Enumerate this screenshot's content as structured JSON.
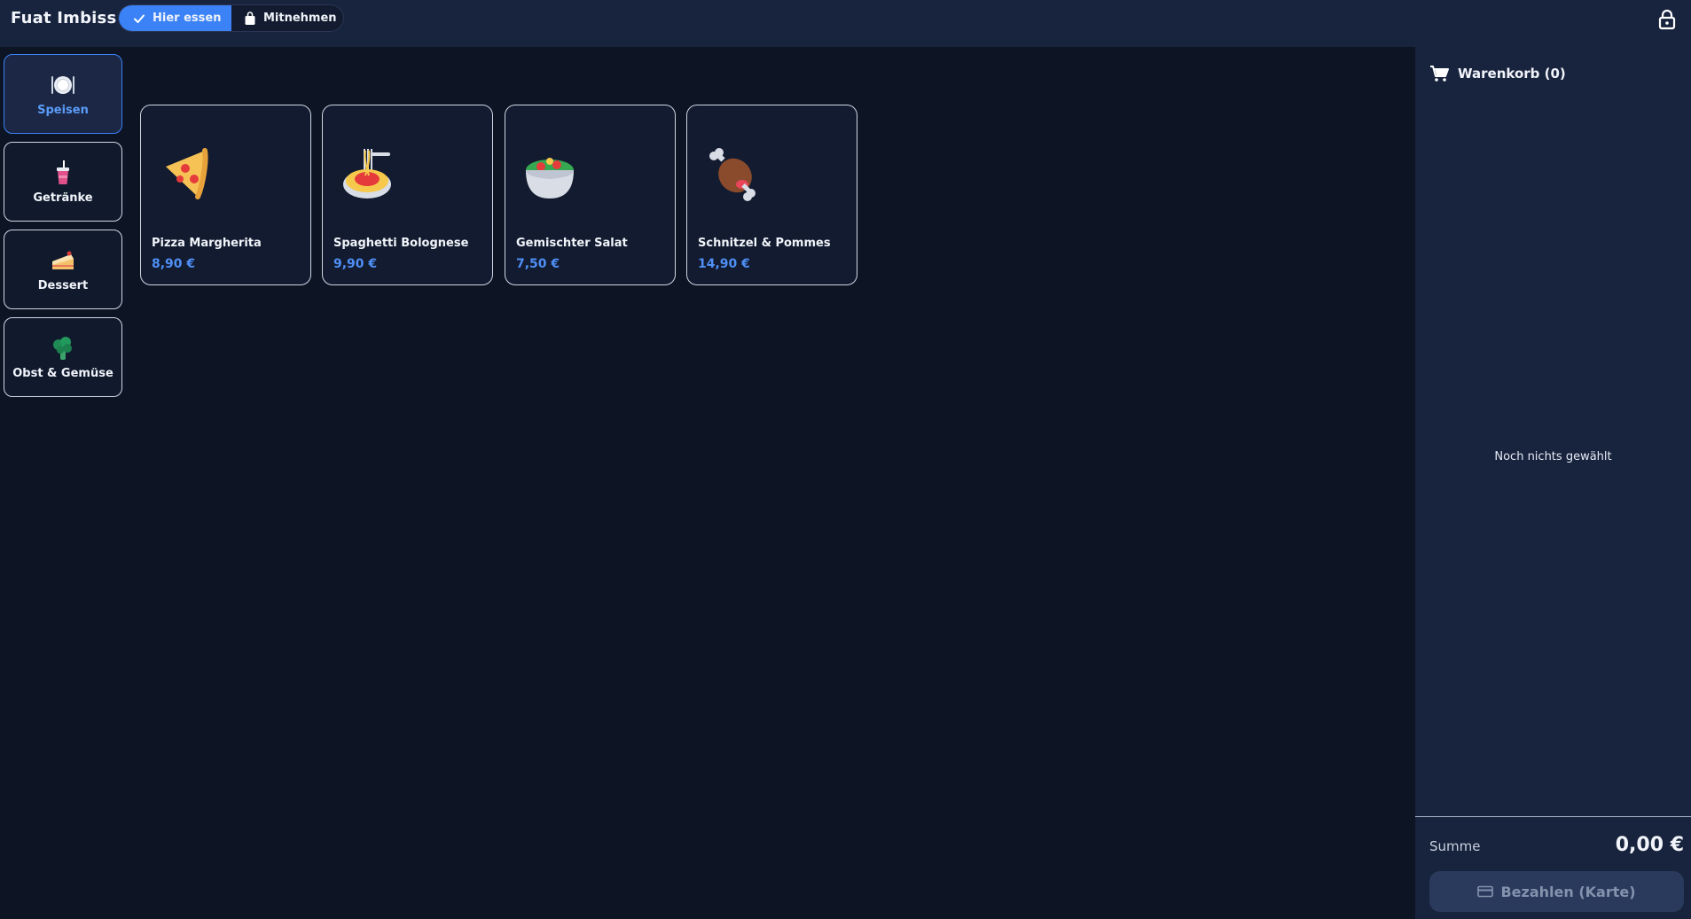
{
  "header": {
    "brand": "Fuat Imbiss",
    "modes": [
      {
        "label": "Hier essen",
        "icon": "check-icon",
        "active": true
      },
      {
        "label": "Mitnehmen",
        "icon": "bag-icon",
        "active": false
      }
    ],
    "lock_icon": "lock-icon"
  },
  "categories": [
    {
      "label": "Speisen",
      "icon": "plate-icon",
      "active": true
    },
    {
      "label": "Getränke",
      "icon": "drink-cup-icon",
      "active": false
    },
    {
      "label": "Dessert",
      "icon": "cake-slice-icon",
      "active": false
    },
    {
      "label": "Obst & Gemüse",
      "icon": "broccoli-icon",
      "active": false
    }
  ],
  "products": [
    {
      "name": "Pizza Margherita",
      "price": "8,90 €",
      "icon": "pizza-icon"
    },
    {
      "name": "Spaghetti Bolognese",
      "price": "9,90 €",
      "icon": "spaghetti-icon"
    },
    {
      "name": "Gemischter Salat",
      "price": "7,50 €",
      "icon": "salad-icon"
    },
    {
      "name": "Schnitzel & Pommes",
      "price": "14,90 €",
      "icon": "meat-icon"
    }
  ],
  "cart": {
    "title": "Warenkorb (0)",
    "empty_text": "Noch nichts gewählt",
    "sum_label": "Summe",
    "sum_value": "0,00 €",
    "pay_label": "Bezahlen (Karte)"
  },
  "colors": {
    "accent": "#3b82f6",
    "background": "#0d1424",
    "panel": "#18233d",
    "price": "#4f8ff6"
  }
}
